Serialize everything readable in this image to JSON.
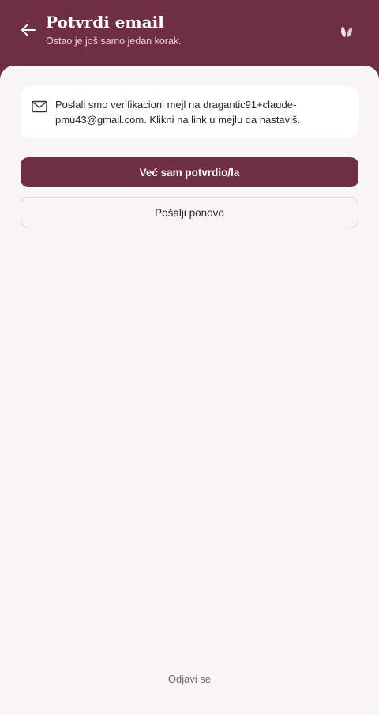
{
  "header": {
    "title": "Potvrdi email",
    "subtitle": "Ostao je još samo jedan korak.",
    "back_icon": "arrow-left-icon",
    "logo_icon": "leaf-logo-icon"
  },
  "notice": {
    "icon": "mail-icon",
    "text": "Poslali smo verifikacioni mejl na dragantic91+claude-pmu43@gmail.com. Klikni na link u mejlu da nastaviš."
  },
  "actions": {
    "confirmed_label": "Već sam potvrdio/la",
    "resend_label": "Pošalji ponovo"
  },
  "footer": {
    "logout_label": "Odjavi se"
  },
  "colors": {
    "brand": "#6e2e44",
    "background": "#f8f6f4",
    "card": "#ffffff",
    "text": "#2c2428",
    "muted": "#6f6a6c"
  }
}
